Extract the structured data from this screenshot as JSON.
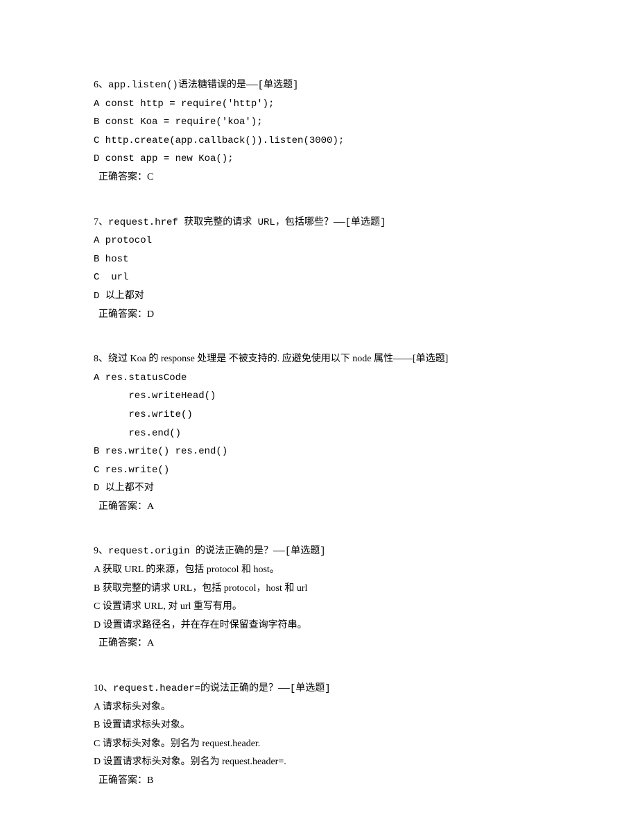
{
  "questions": [
    {
      "num": "6",
      "prompt": "、app.listen()语法糖错误的是——[单选题]",
      "prompt_mono": true,
      "options": [
        "A const http = require('http');",
        "B const Koa = require('koa');",
        "C http.create(app.callback()).listen(3000);",
        "D const app = new Koa();"
      ],
      "options_mono": true,
      "answer": "正确答案：C"
    },
    {
      "num": "7",
      "prompt": "、request.href 获取完整的请求 URL，包括哪些？——[单选题]",
      "prompt_mono": true,
      "options": [
        "A protocol",
        "B host",
        "C  url",
        "D 以上都对"
      ],
      "options_mono": true,
      "answer": "正确答案：D"
    },
    {
      "num": "8",
      "prompt": "、绕过 Koa 的 response 处理是 不被支持的. 应避免使用以下 node 属性——[单选题]",
      "prompt_mono": false,
      "options": [
        "A res.statusCode",
        "      res.writeHead()",
        "      res.write()",
        "      res.end()",
        "B res.write() res.end()",
        "C res.write()",
        "D 以上都不对"
      ],
      "options_mono": true,
      "answer": "正确答案：A"
    },
    {
      "num": "9",
      "prompt": "、request.origin 的说法正确的是？——[单选题]",
      "prompt_mono": true,
      "options": [
        "A 获取 URL 的来源，包括 protocol 和 host。",
        "B 获取完整的请求 URL，包括 protocol，host 和 url",
        "C 设置请求 URL, 对 url 重写有用。",
        "D 设置请求路径名，并在存在时保留查询字符串。"
      ],
      "options_mono": false,
      "answer": "正确答案：A"
    },
    {
      "num": "10",
      "prompt": "、request.header=的说法正确的是？——[单选题]",
      "prompt_mono": true,
      "options": [
        "A 请求标头对象。",
        "B 设置请求标头对象。",
        "C 请求标头对象。别名为 request.header.",
        "D 设置请求标头对象。别名为 request.header=."
      ],
      "options_mono": false,
      "answer": "正确答案：B"
    }
  ]
}
